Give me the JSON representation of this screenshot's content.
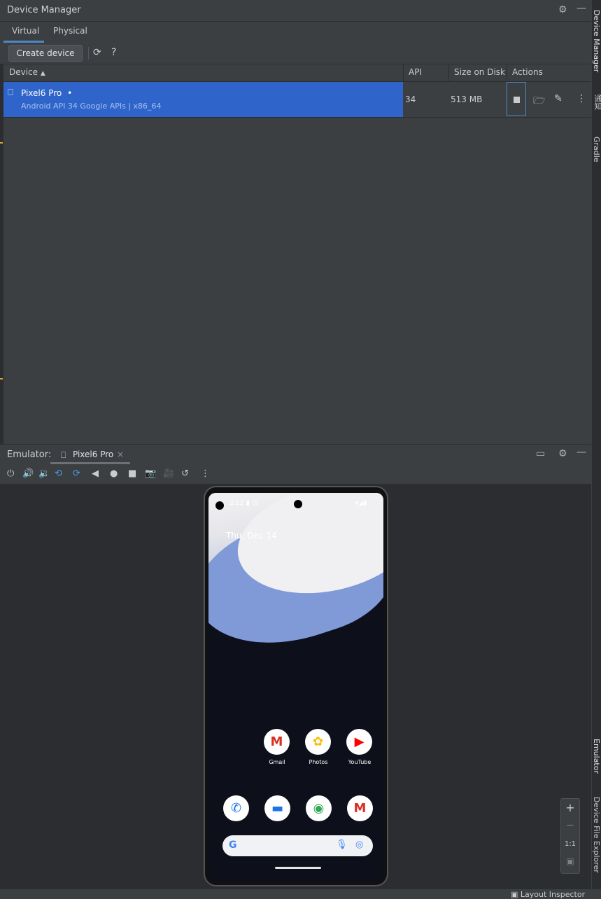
{
  "device_manager": {
    "title": "Device Manager",
    "tabs": [
      "Virtual",
      "Physical"
    ],
    "create_button": "Create device",
    "help": "?",
    "columns": {
      "device": "Device",
      "api": "API",
      "size": "Size on Disk",
      "actions": "Actions"
    },
    "device": {
      "name": "Pixel6 Pro",
      "status_dot": "•",
      "details": "Android API 34 Google APIs | x86_64",
      "api": "34",
      "size": "513 MB"
    }
  },
  "side_tools": {
    "device_manager": "Device Manager",
    "notifications": "通知",
    "gradle": "Gradle",
    "emulator": "Emulator",
    "device_file_explorer": "Device File Explorer"
  },
  "emulator": {
    "label": "Emulator:",
    "tab_name": "Pixel6 Pro",
    "close": "×",
    "zoom": {
      "plus": "+",
      "minus": "−",
      "one_to_one": "1:1"
    }
  },
  "phone": {
    "time": "3:12",
    "date": "Thu, Dec 14",
    "apps": [
      {
        "label": "Gmail",
        "glyph": "M",
        "color": "#d93025"
      },
      {
        "label": "Photos",
        "glyph": "✿",
        "color": "#fbbc04"
      },
      {
        "label": "YouTube",
        "glyph": "▶",
        "color": "#ff0000"
      }
    ],
    "dock": [
      {
        "glyph": "✆",
        "color": "#1a73e8"
      },
      {
        "glyph": "▬",
        "color": "#1a73e8"
      },
      {
        "glyph": "◉",
        "color": "#34a853"
      },
      {
        "glyph": "M",
        "color": "#d93025"
      }
    ],
    "search_g": "G"
  },
  "bottom": {
    "layout_inspector": "Layout Inspector"
  }
}
